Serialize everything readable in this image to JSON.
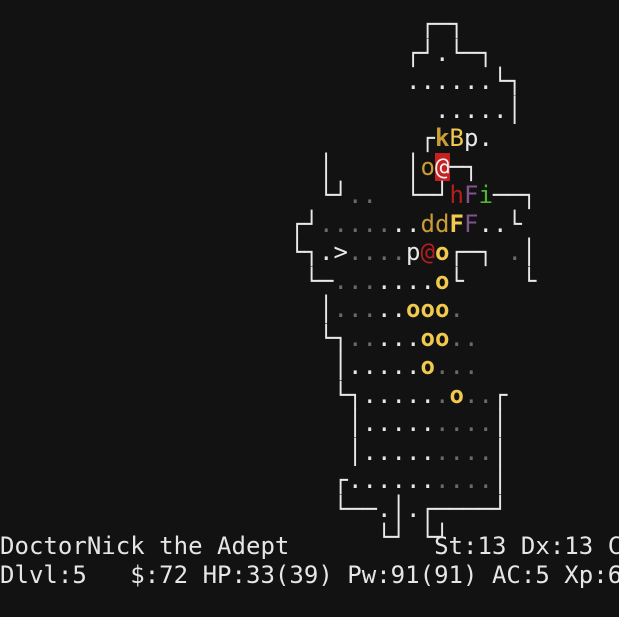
{
  "palette": {
    "wall": "#e8e8e8",
    "lit_floor": "#e8e8e8",
    "dark_floor": "#6b6b6b",
    "dungeon_feature": "#e8e8e8",
    "orange": "#c99d33",
    "yellow": "#f1c94e",
    "red": "#b51e1e",
    "magenta": "#83548c",
    "green": "#4cb62c",
    "player_bg": "#c62020",
    "player_fg": "#f0f0f0"
  },
  "map_rows": [
    "                             ┌─┐     ",
    "                            ┌┘.└─┐   ",
    "                            ......└┐ ",
    "                              .....│ ",
    "                             ┌kBp.  ",
    "                      │     │o@─┐   ",
    "                      └┘..  └─┘hFi──┐",
    "                    ┌┘.......ddFF..└",
    "                    └┐.>....p@o┌─┐ .│",
    "                     └─.......o└    └",
    "                      │.....ooo.    ",
    "                      └┐.....oo..   ",
    "                       │.....o...   ",
    "                       └┐......o..┌ ",
    "                        │.........│ ",
    "                        │.........│ ",
    "                       ┌..........│ ",
    "                       └──.│.┌────┘ ",
    "                          └┘ └┘    "
  ],
  "glyph_colors": {
    "k": "orange",
    "B": "yellow",
    "p": "lit_floor",
    "o": "yellow",
    "h": "red",
    "F": "magenta",
    "i": "green",
    "d": "orange",
    ">": "dungeon_feature",
    "@": "red"
  },
  "status": {
    "line1": "DoctorNick the Adept          St:13 Dx:13 Co",
    "line2": "Dlvl:5   $:72 HP:33(39) Pw:91(91) AC:5 Xp:6"
  }
}
